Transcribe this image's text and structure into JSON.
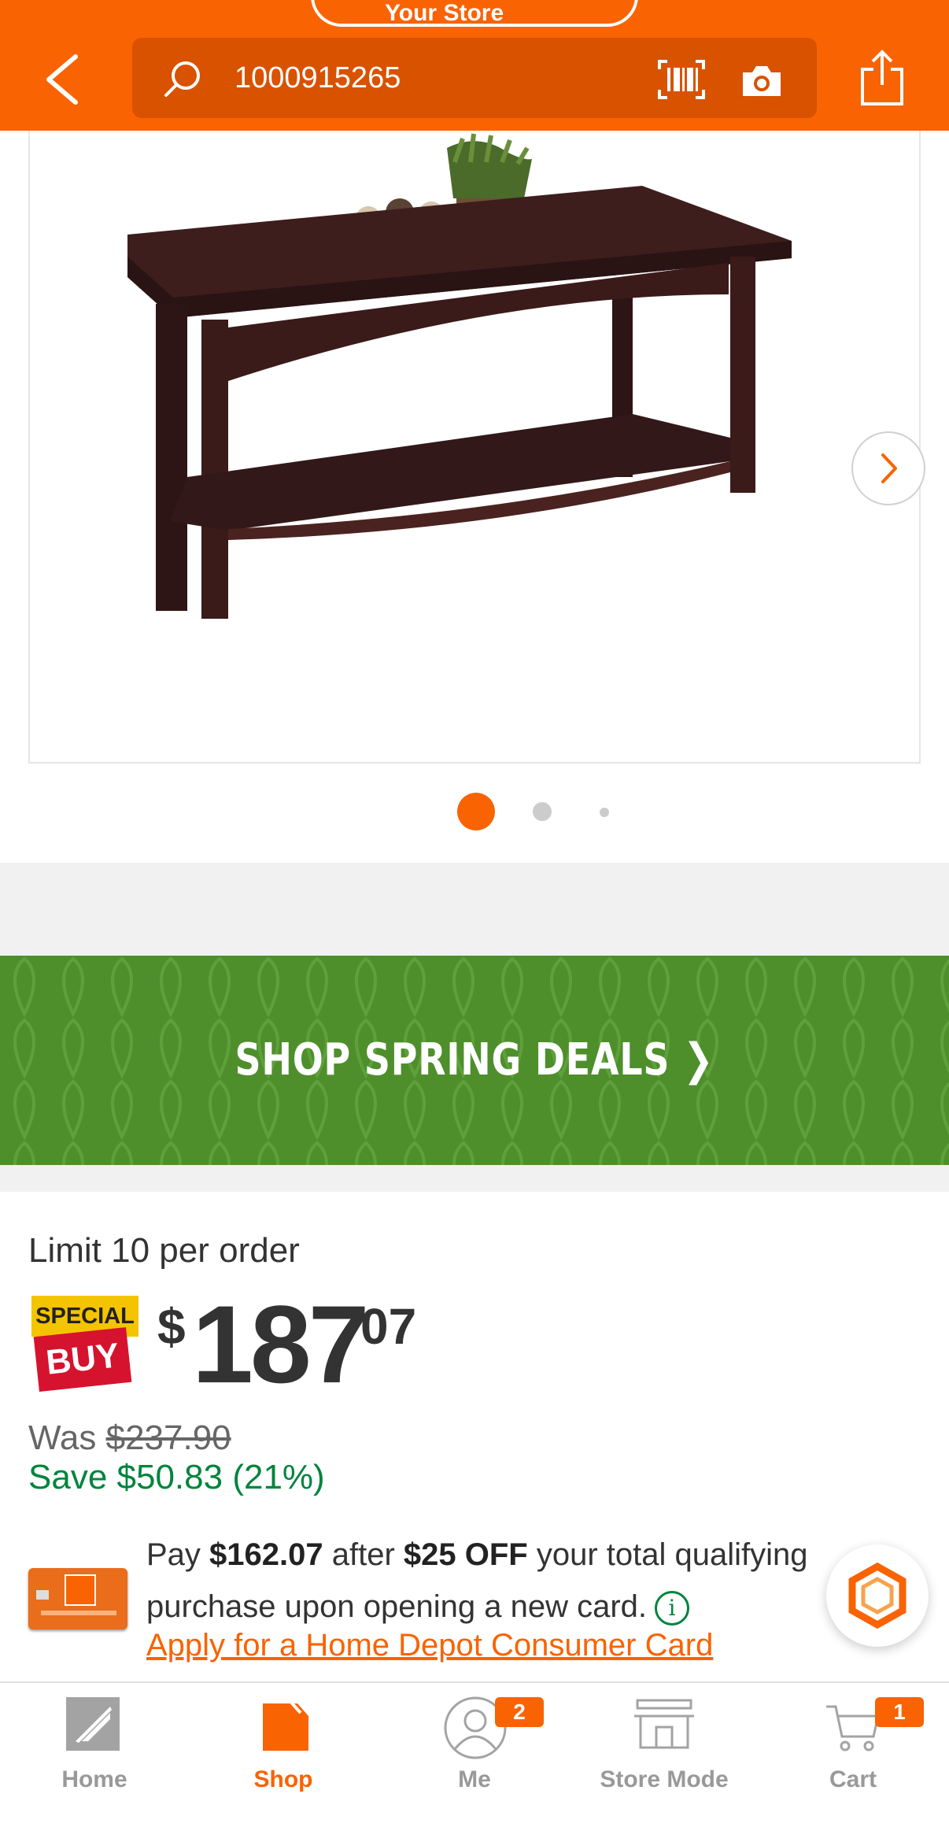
{
  "header": {
    "store_label": "Your Store",
    "search_text": "1000915265"
  },
  "pager": {
    "current_page": 1,
    "page_count": 3
  },
  "banner": {
    "text": "SHOP SPRING DEALS ❯"
  },
  "pricing": {
    "limit_text": "Limit 10 per order",
    "badge_top": "SPECIAL",
    "badge_bottom": "BUY",
    "currency": "$",
    "price_dollars": "187",
    "price_cents": "07",
    "was_label": "Was ",
    "was_price": "$237.90",
    "save_text": "Save $50.83 (21%)"
  },
  "card_offer": {
    "pay_label": "Pay ",
    "pay_amount": "$162.07",
    "after_label": " after ",
    "discount": "$25 OFF",
    "rest_line": " your total qualifying purchase upon opening a new card.",
    "info_glyph": "i",
    "apply_link": "Apply for a Home Depot Consumer Card"
  },
  "bottom_nav": {
    "items": [
      {
        "label": "Home"
      },
      {
        "label": "Shop"
      },
      {
        "label": "Me",
        "badge": "2"
      },
      {
        "label": "Store Mode"
      },
      {
        "label": "Cart",
        "badge": "1"
      }
    ],
    "active": "Shop"
  },
  "colors": {
    "brand_orange": "#f96302",
    "banner_green": "#4e8f2c",
    "save_green": "#00843d",
    "special_yellow": "#f5c400",
    "special_red": "#d5132e"
  },
  "icons": {
    "back": "chevron-left-icon",
    "search": "search-icon",
    "barcode": "barcode-icon",
    "camera": "camera-icon",
    "share": "share-icon",
    "next": "chevron-right-icon",
    "chat": "chat-hexagon-icon"
  }
}
